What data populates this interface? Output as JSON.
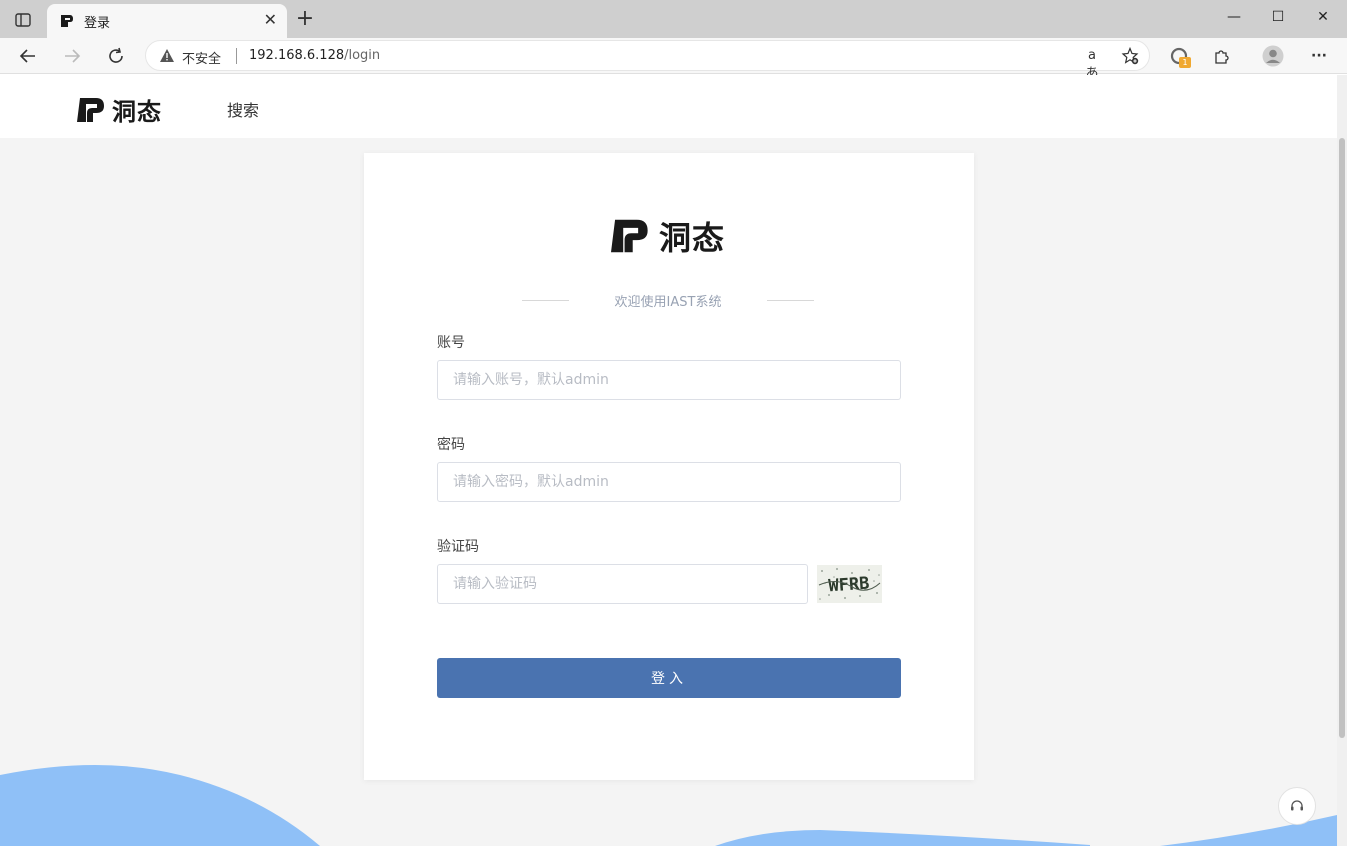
{
  "browser": {
    "tab_title": "登录",
    "tab_close": "✕",
    "new_tab": "+",
    "not_secure": "不安全",
    "url_host": "192.168.6.128",
    "url_path": "/login",
    "read_aloud": "aあ",
    "extension_badge": "1",
    "more_menu": "···",
    "window_minimize": "—",
    "window_maximize": "☐",
    "window_close": "✕"
  },
  "nav": {
    "brand": "洞态",
    "search_link": "搜索"
  },
  "login": {
    "brand": "洞态",
    "welcome": "欢迎使用IAST系统",
    "account_label": "账号",
    "account_placeholder": "请输入账号，默认admin",
    "password_label": "密码",
    "password_placeholder": "请输入密码，默认admin",
    "captcha_label": "验证码",
    "captcha_placeholder": "请输入验证码",
    "captcha_text": "WFRB",
    "submit_label": "登入"
  },
  "colors": {
    "primary_button": "#4a73b0",
    "wave": "#8fc0f7",
    "logo_accent": "#e83a2c"
  }
}
